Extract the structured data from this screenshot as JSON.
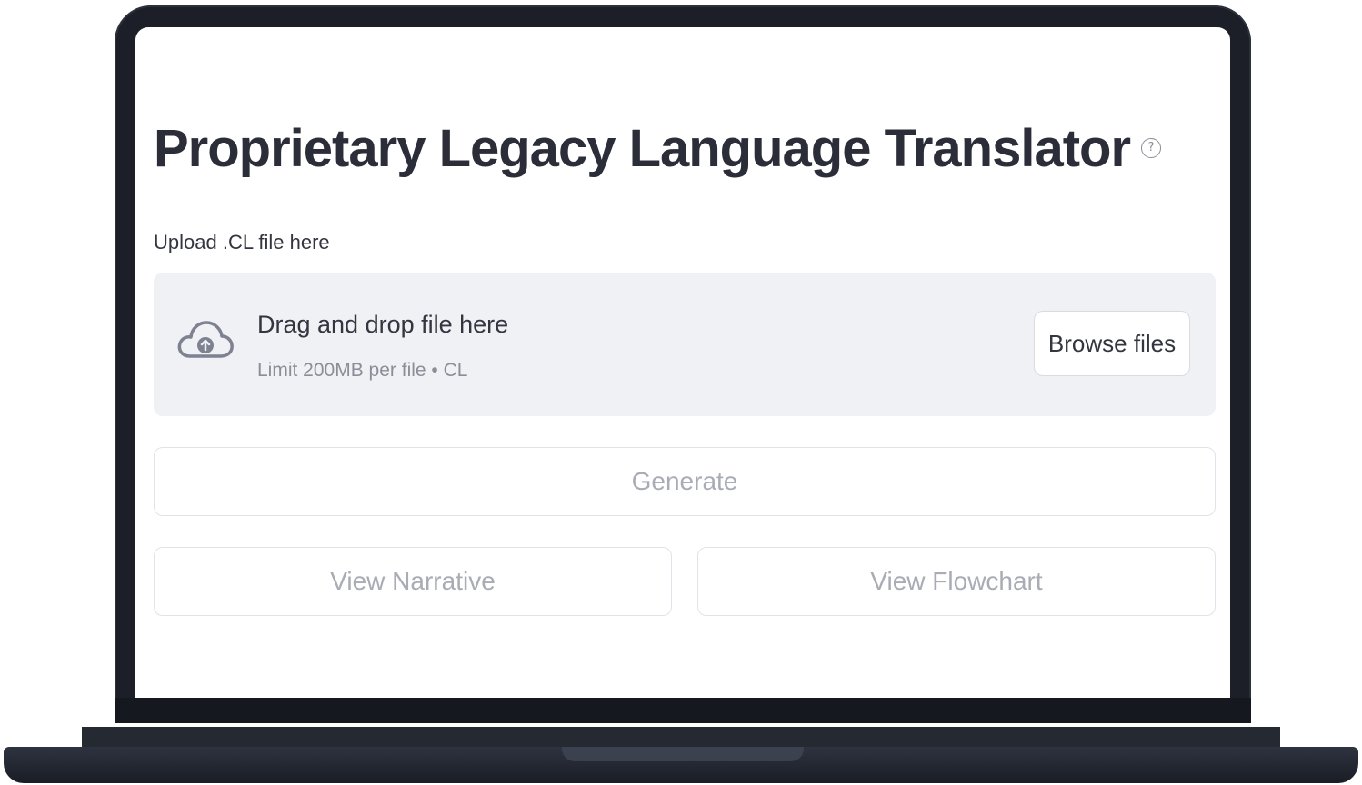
{
  "app": {
    "title": "Proprietary Legacy Language Translator",
    "help_icon": "question-circle-icon"
  },
  "uploader": {
    "label": "Upload .CL file here",
    "icon": "cloud-upload-icon",
    "drop_title": "Drag and drop file here",
    "drop_limit": "Limit 200MB per file • CL",
    "browse_label": "Browse files"
  },
  "actions": {
    "generate_label": "Generate",
    "view_narrative_label": "View Narrative",
    "view_flowchart_label": "View Flowchart"
  },
  "colors": {
    "title_text": "#2b2d38",
    "dropzone_bg": "#f0f1f5",
    "disabled_text": "#a9acb4",
    "laptop_frame": "#1c1f28"
  }
}
